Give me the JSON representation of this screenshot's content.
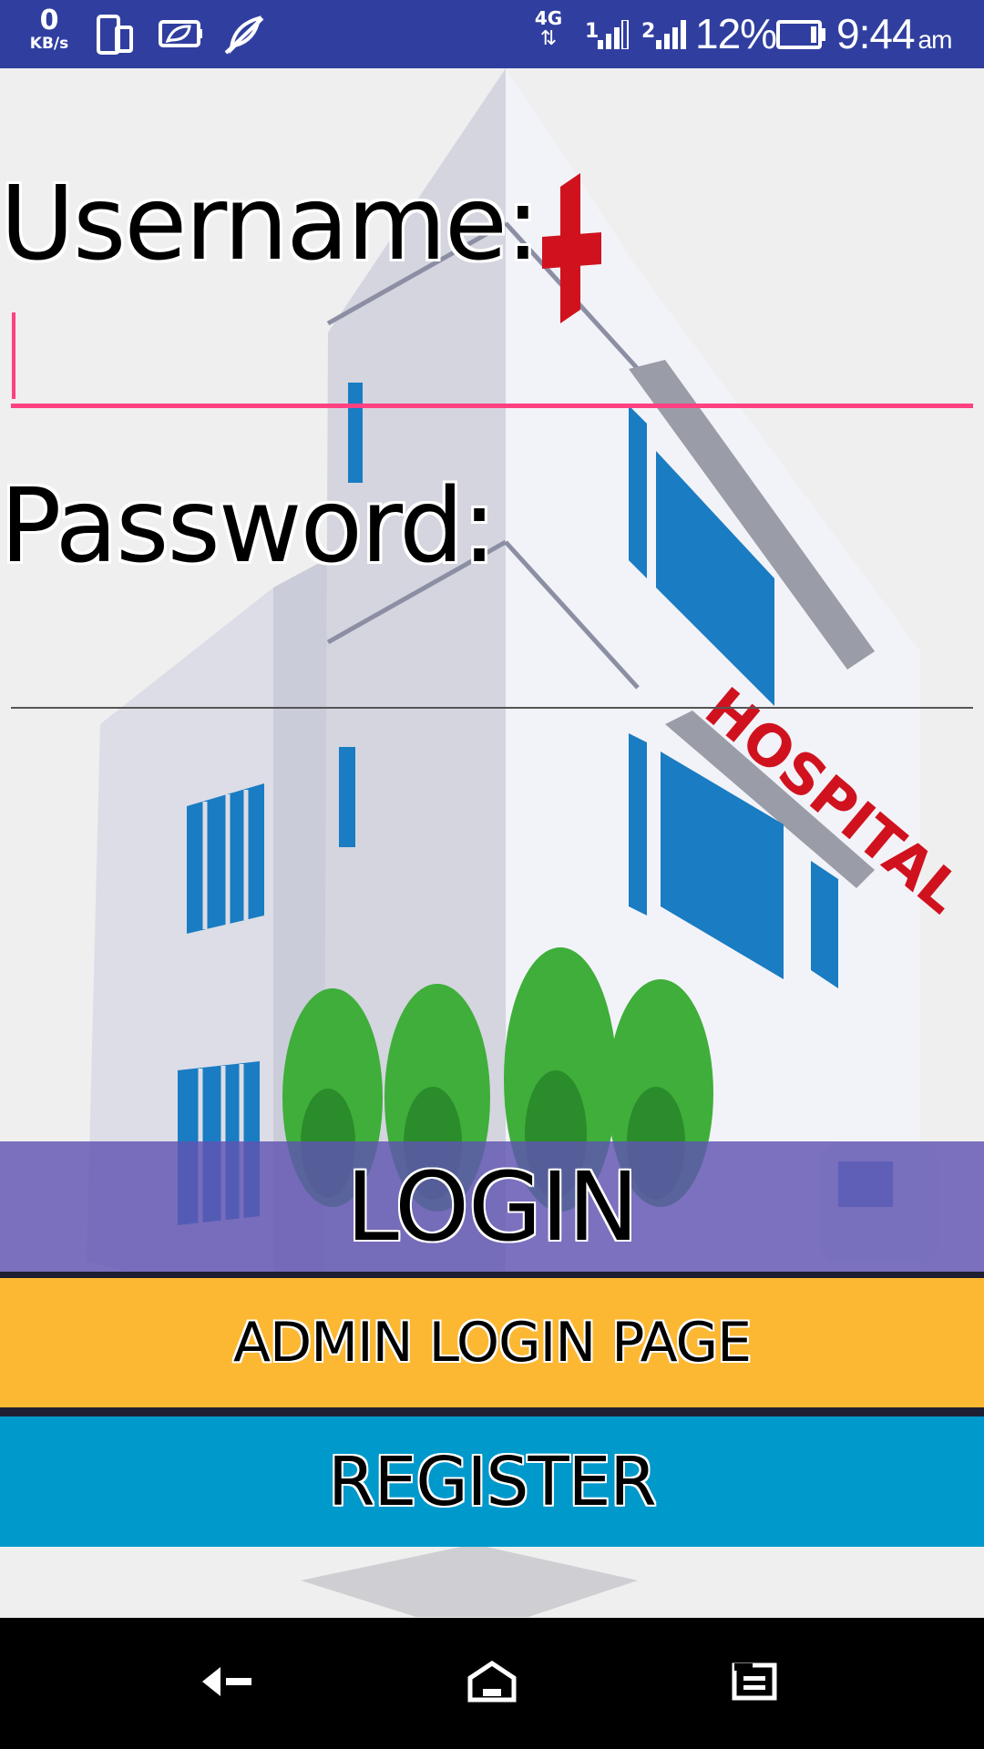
{
  "status_bar": {
    "speed_value": "0",
    "speed_unit": "KB/s",
    "network_type": "4G",
    "network_arrows": "⇅",
    "sim1_label": "1",
    "sim2_label": "2",
    "battery_percent": "12%",
    "time": "9:44",
    "ampm": "am",
    "icons": [
      "device-rotate-icon",
      "leaf-power-saver-icon",
      "feather-muted-icon",
      "signal-sim1-icon",
      "signal-sim2-icon",
      "battery-icon"
    ]
  },
  "background": {
    "sign_text": "HOSPITAL",
    "colors": {
      "building": "#dcdce6",
      "window": "#1a7cc2",
      "cross": "#d0121f",
      "tree": "#3fae3a"
    }
  },
  "form": {
    "username_label": "Username:",
    "username_value": "",
    "password_label": "Password:",
    "password_value": "",
    "accent_color": "#ff4081"
  },
  "buttons": {
    "login": "LOGIN",
    "admin": "ADMIN LOGIN PAGE",
    "register": "REGISTER",
    "colors": {
      "login": "#6054b2",
      "admin": "#fdb833",
      "register": "#0099cc"
    }
  },
  "nav_bar": {
    "icons": [
      "back-icon",
      "home-icon",
      "recents-icon"
    ]
  }
}
